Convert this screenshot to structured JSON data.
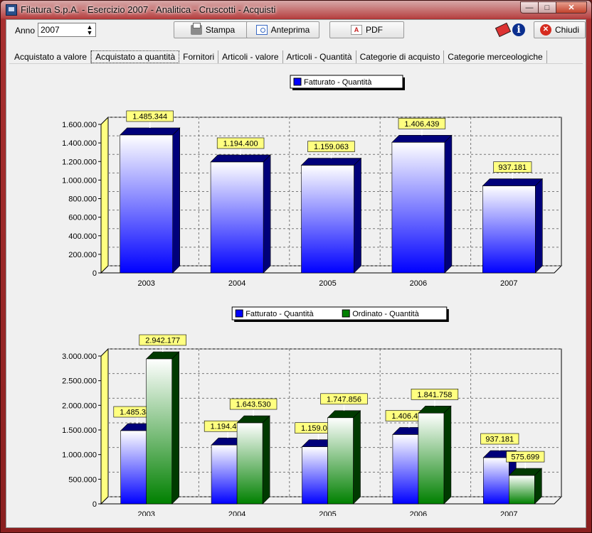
{
  "window": {
    "title": "Filatura S.p.A. - Esercizio 2007 - Analitica - Cruscotti - Acquisti"
  },
  "toolbar": {
    "anno_label": "Anno",
    "anno_value": "2007",
    "stampa": "Stampa",
    "anteprima": "Anteprima",
    "pdf": "PDF",
    "chiudi": "Chiudi"
  },
  "tabs": [
    "Acquistato a valore",
    "Acquistato a quantità",
    "Fornitori",
    "Articoli - valore",
    "Articoli - Quantità",
    "Categorie di acquisto",
    "Categorie merceologiche"
  ],
  "active_tab": 1,
  "colors": {
    "fatturato": "#0000ff",
    "fatturato_dark": "#00007a",
    "ordinato": "#008000",
    "ordinato_dark": "#003a00",
    "side_wall": "#ffff80",
    "label_bg": "#ffff80"
  },
  "chart_data": [
    {
      "type": "bar",
      "categories": [
        "2003",
        "2004",
        "2005",
        "2006",
        "2007"
      ],
      "series": [
        {
          "name": "Fatturato - Quantità",
          "values": [
            1485344,
            1194400,
            1159063,
            1406439,
            937181
          ]
        }
      ],
      "data_labels": [
        [
          "1.485.344",
          "1.194.400",
          "1.159.063",
          "1.406.439",
          "937.181"
        ]
      ],
      "yticks": [
        "0",
        "200.000",
        "400.000",
        "600.000",
        "800.000",
        "1.000.000",
        "1.200.000",
        "1.400.000",
        "1.600.000"
      ],
      "ylim": [
        0,
        1600000
      ],
      "legend": "top-center",
      "grid": true
    },
    {
      "type": "bar",
      "categories": [
        "2003",
        "2004",
        "2005",
        "2006",
        "2007"
      ],
      "series": [
        {
          "name": "Fatturato - Quantità",
          "values": [
            1485344,
            1194400,
            1159063,
            1406439,
            937181
          ]
        },
        {
          "name": "Ordinato - Quantità",
          "values": [
            2942177,
            1643530,
            1747856,
            1841758,
            575699
          ]
        }
      ],
      "data_labels": [
        [
          "1.485.344",
          "1.194.400",
          "1.159.063",
          "1.406.439",
          "937.181"
        ],
        [
          "2.942.177",
          "1.643.530",
          "1.747.856",
          "1.841.758",
          "575.699"
        ]
      ],
      "yticks": [
        "0",
        "500.000",
        "1.000.000",
        "1.500.000",
        "2.000.000",
        "2.500.000",
        "3.000.000"
      ],
      "ylim": [
        0,
        3000000
      ],
      "legend": "top-center",
      "grid": true
    }
  ]
}
